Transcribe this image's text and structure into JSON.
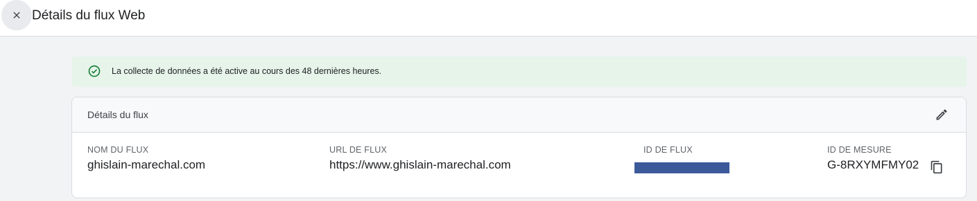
{
  "header": {
    "title": "Détails du flux Web",
    "close_icon": "close-icon"
  },
  "banner": {
    "icon": "check-circle-icon",
    "text": "La collecte de données a été active au cours des 48 dernières heures.",
    "color": "#188038"
  },
  "card": {
    "title": "Détails du flux",
    "edit_icon": "pencil-icon",
    "fields": {
      "stream_name": {
        "label": "NOM DU FLUX",
        "value": "ghislain-marechal.com"
      },
      "stream_url": {
        "label": "URL DE FLUX",
        "value": "https://www.ghislain-marechal.com"
      },
      "stream_id": {
        "label": "ID DE FLUX",
        "value_redacted": true
      },
      "measurement_id": {
        "label": "ID DE MESURE",
        "value": "G-8RXYMFMY02",
        "copy_icon": "copy-icon"
      }
    }
  }
}
